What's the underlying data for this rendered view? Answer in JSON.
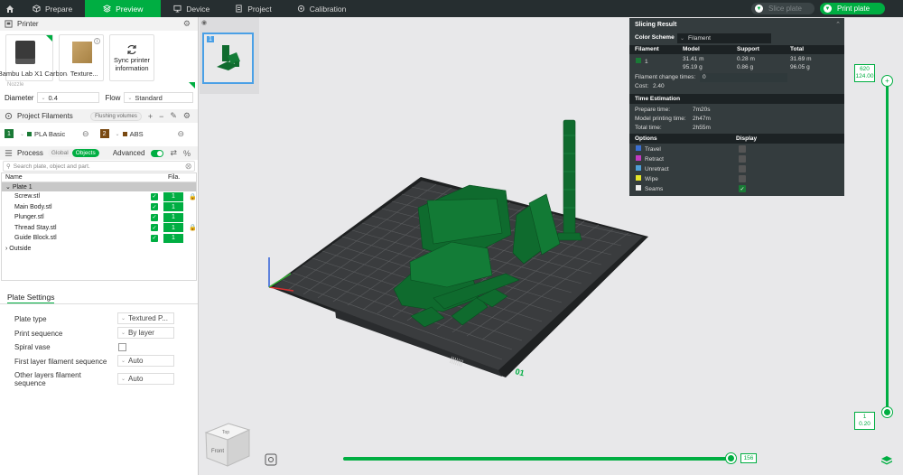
{
  "topbar": {
    "tabs": [
      {
        "label": "Prepare",
        "icon": "cube-icon"
      },
      {
        "label": "Preview",
        "icon": "layers-icon"
      },
      {
        "label": "Device",
        "icon": "monitor-icon"
      },
      {
        "label": "Project",
        "icon": "document-icon"
      },
      {
        "label": "Calibration",
        "icon": "target-icon"
      }
    ],
    "active_tab": "Preview",
    "slice_label": "Slice plate",
    "print_label": "Print plate"
  },
  "printer": {
    "section_title": "Printer",
    "printer_name": "Bambu Lab X1 Carbon",
    "plate_name": "Texture...",
    "sync_label_1": "Sync printer",
    "sync_label_2": "information",
    "nozzle_label": "Nozzle",
    "diameter_label": "Diameter",
    "diameter_value": "0.4",
    "flow_label": "Flow",
    "flow_value": "Standard"
  },
  "filaments": {
    "section_title": "Project Filaments",
    "flushing_label": "Flushing volumes",
    "items": [
      {
        "num": "1",
        "name": "PLA Basic",
        "color": "#1a7a36"
      },
      {
        "num": "2",
        "name": "ABS",
        "color": "#7a4a12"
      }
    ]
  },
  "process": {
    "section_title": "Process",
    "global_label": "Global",
    "objects_label": "Objects",
    "advanced_label": "Advanced",
    "search_placeholder": "Search plate, object and part.",
    "col_name": "Name",
    "col_fila": "Fila.",
    "plate_label": "Plate 1",
    "objects": [
      {
        "name": "Screw.stl",
        "fila": "1",
        "locked": true
      },
      {
        "name": "Main Body.stl",
        "fila": "1",
        "locked": false
      },
      {
        "name": "Plunger.stl",
        "fila": "1",
        "locked": false
      },
      {
        "name": "Thread Stay.stl",
        "fila": "1",
        "locked": true
      },
      {
        "name": "Guide Block.stl",
        "fila": "1",
        "locked": false
      }
    ],
    "outside_label": "Outside"
  },
  "plate_settings": {
    "tab_label": "Plate Settings",
    "plate_type_label": "Plate type",
    "plate_type_value": "Textured P...",
    "print_sequence_label": "Print sequence",
    "print_sequence_value": "By layer",
    "spiral_vase_label": "Spiral vase",
    "first_layer_label": "First layer filament sequence",
    "first_layer_value": "Auto",
    "other_layers_label_1": "Other layers filament",
    "other_layers_label_2": "sequence",
    "other_layers_value": "Auto"
  },
  "thumbnail": {
    "index": "1"
  },
  "slicing_result": {
    "title": "Slicing Result",
    "color_scheme_label": "Color Scheme",
    "color_scheme_value": "Filament",
    "headers": {
      "filament": "Filament",
      "model": "Model",
      "support": "Support",
      "total": "Total"
    },
    "row": {
      "num": "1",
      "model_m": "31.41 m",
      "model_g": "95.19 g",
      "support_m": "0.28 m",
      "support_g": "0.86 g",
      "total_m": "31.69 m",
      "total_g": "96.05 g"
    },
    "filament_change_label": "Filament change times:",
    "filament_change_value": "0",
    "cost_label": "Cost:",
    "cost_value": "2.40",
    "time_title": "Time Estimation",
    "prepare_time_label": "Prepare time:",
    "prepare_time_value": "7m20s",
    "model_time_label": "Model printing time:",
    "model_time_value": "2h47m",
    "total_time_label": "Total time:",
    "total_time_value": "2h55m",
    "options_label": "Options",
    "display_label": "Display",
    "options": [
      {
        "name": "Travel",
        "color": "#3b6fd1",
        "checked": false
      },
      {
        "name": "Retract",
        "color": "#c23bc2",
        "checked": false
      },
      {
        "name": "Unretract",
        "color": "#4f9fd8",
        "checked": false
      },
      {
        "name": "Wipe",
        "color": "#e6e62b",
        "checked": false
      },
      {
        "name": "Seams",
        "color": "#eeeeee",
        "checked": true
      }
    ]
  },
  "layer_slider": {
    "top_layer": "620",
    "top_height": "124.00",
    "bottom_layer": "1",
    "bottom_height": "0.20",
    "horizontal_value": "156"
  },
  "plate_label_3d": "01",
  "view_cube": {
    "top": "Top",
    "front": "Front"
  },
  "colors": {
    "accent": "#00ae42",
    "topbar": "#262e30",
    "model": "#0f6b2e"
  }
}
